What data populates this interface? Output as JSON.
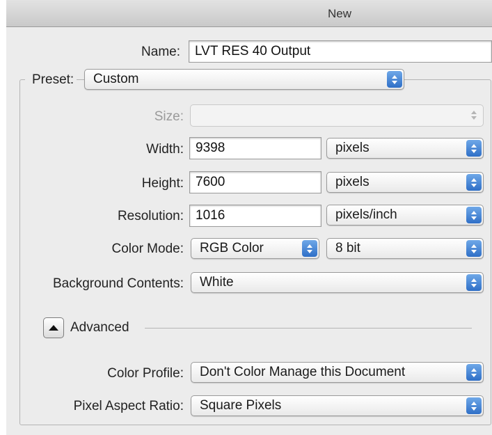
{
  "window": {
    "title": "New"
  },
  "name": {
    "label": "Name:",
    "value": "LVT RES 40 Output"
  },
  "preset": {
    "label": "Preset:",
    "value": "Custom"
  },
  "size": {
    "label": "Size:",
    "value": ""
  },
  "width": {
    "label": "Width:",
    "value": "9398",
    "unit": "pixels"
  },
  "height": {
    "label": "Height:",
    "value": "7600",
    "unit": "pixels"
  },
  "resolution": {
    "label": "Resolution:",
    "value": "1016",
    "unit": "pixels/inch"
  },
  "color_mode": {
    "label": "Color Mode:",
    "value": "RGB Color",
    "depth": "8 bit"
  },
  "background_contents": {
    "label": "Background Contents:",
    "value": "White"
  },
  "advanced": {
    "label": "Advanced"
  },
  "color_profile": {
    "label": "Color Profile:",
    "value": "Don't Color Manage this Document"
  },
  "pixel_aspect_ratio": {
    "label": "Pixel Aspect Ratio:",
    "value": "Square Pixels"
  },
  "colors": {
    "accent": "#2f6fc7",
    "dialog_bg": "#ececec",
    "disabled_text": "#9a9a9a"
  }
}
